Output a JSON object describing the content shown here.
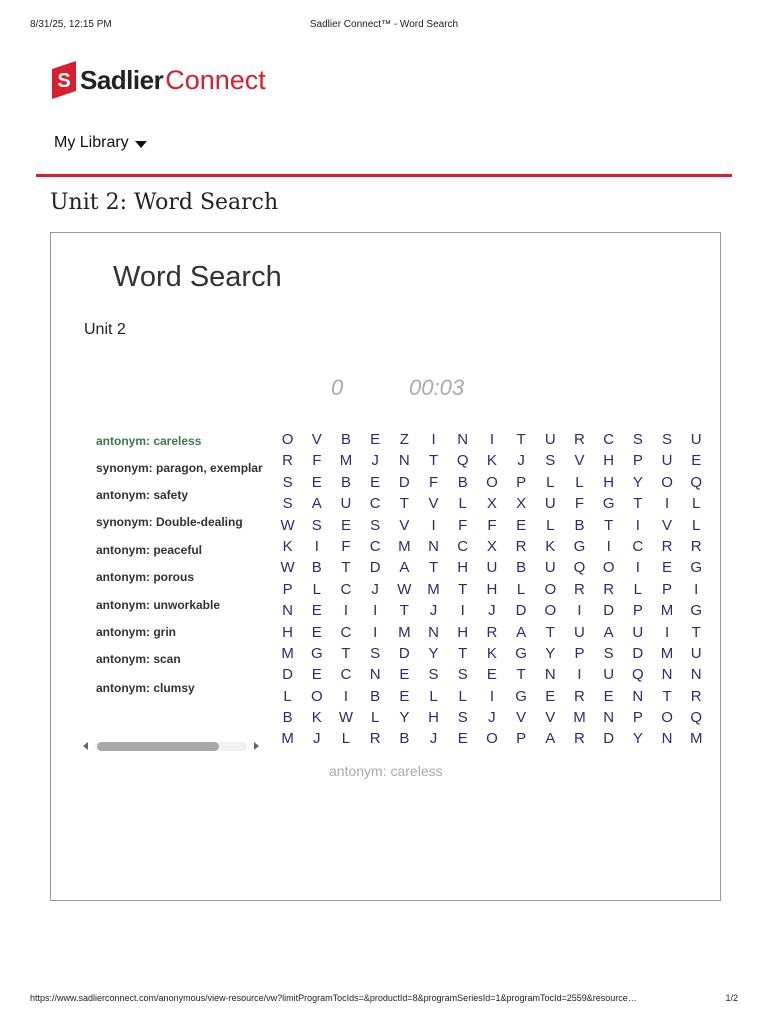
{
  "print_header": {
    "datetime": "8/31/25, 12:15 PM",
    "page_title": "Sadlier Connect™ - Word Search"
  },
  "brand": {
    "name_bold": "Sadlier",
    "name_light": "Connect",
    "icon": "sadlier-s-logo-icon",
    "accent_color": "#d7202f"
  },
  "nav": {
    "library_label": "My Library",
    "library_icon": "caret-down-icon"
  },
  "unit_title": "Unit 2: Word Search",
  "activity": {
    "heading": "Word Search",
    "subheading": "Unit 2",
    "score": "0",
    "timer": "00:03",
    "current_clue": "antonym: careless",
    "clues": [
      {
        "label": "antonym: careless",
        "active": true
      },
      {
        "label": "synonym: paragon, exemplar",
        "active": false
      },
      {
        "label": "antonym: safety",
        "active": false
      },
      {
        "label": "synonym: Double-dealing",
        "active": false
      },
      {
        "label": "antonym: peaceful",
        "active": false
      },
      {
        "label": "antonym: porous",
        "active": false
      },
      {
        "label": "antonym: unworkable",
        "active": false
      },
      {
        "label": "antonym: grin",
        "active": false
      },
      {
        "label": "antonym: scan",
        "active": false
      },
      {
        "label": "antonym: clumsy",
        "active": false
      }
    ],
    "grid": [
      "OVBEZINITURCSSU",
      "RFMJNTQKJSVHPUE",
      "SEBEDFBOPLLHYOQ",
      "SAUCTVLXXUFGTIL",
      "WSESVIFFELBTIVL",
      "KIFCMNCXRKGICRR",
      "WBTDATHUBUQOIEG",
      "PLCJWMTHLORRLPI",
      "NEIITJIJDOIDPMG",
      "HECIMNHRATUAUIT",
      "MGTSDYTKGYPSDMU",
      "DECNESSETNIUQNN",
      "LOIBELLIGERENTR",
      "BKWLYHSJVVMNPOQ",
      "MJLRBJEOPARDYNM"
    ],
    "letter_color": "#2e2b6e"
  },
  "print_footer": {
    "url": "https://www.sadlierconnect.com/anonymous/view-resource/vw?limitProgramTocIds=&productId=8&programSeriesId=1&programTocId=2559&resource…",
    "page": "1/2"
  }
}
